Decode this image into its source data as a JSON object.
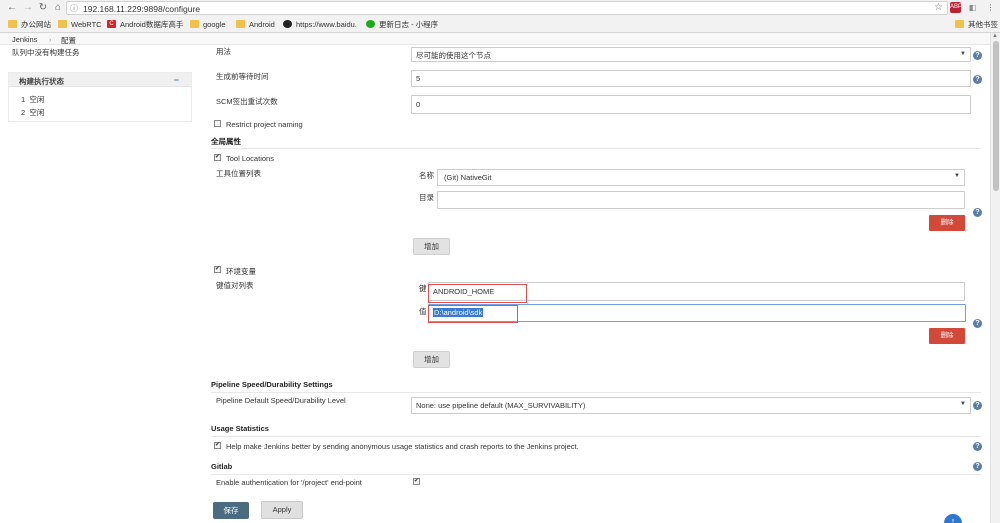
{
  "browser": {
    "url": "192.168.11.229:9898/configure",
    "bookmarks": [
      "办公网站",
      "WebRTC",
      "Android数据库高手",
      "google",
      "Android",
      "https://www.baidu.",
      "更新日志 - 小程序"
    ],
    "other_bookmarks": "其他书签"
  },
  "breadcrumb": {
    "root": "Jenkins",
    "sep": "›",
    "current": "配置"
  },
  "sidebar": {
    "queue_message": "队列中没有构建任务",
    "executor_title": "构建执行状态",
    "collapse_symbol": "−",
    "executors": [
      {
        "num": "1",
        "status": "空闲"
      },
      {
        "num": "2",
        "status": "空闲"
      }
    ]
  },
  "form": {
    "usage_label": "用法",
    "usage_value": "尽可能的使用这个节点",
    "quiet_period_label": "生成前等待时间",
    "quiet_period_value": "5",
    "scm_retry_label": "SCM签出重试次数",
    "scm_retry_value": "0",
    "restrict_naming_label": "Restrict project naming",
    "global_props_title": "全局属性",
    "tool_locations_label": "Tool Locations",
    "tool_list_label": "工具位置列表",
    "tool_name_label": "名称",
    "tool_name_value": "(Git) NativeGit",
    "tool_dir_label": "目录",
    "tool_dir_value": "",
    "delete_label": "删除",
    "add_label": "增加",
    "env_vars_label": "环境变量",
    "kv_list_label": "键值对列表",
    "key_label": "键",
    "key_value": "ANDROID_HOME",
    "value_label": "值",
    "value_value": "D:\\android\\sdk",
    "pipeline_title": "Pipeline Speed/Durability Settings",
    "pipeline_level_label": "Pipeline Default Speed/Durability Level",
    "pipeline_level_value": "None: use pipeline default (MAX_SURVIVABILITY)",
    "usage_stats_title": "Usage Statistics",
    "usage_stats_label": "Help make Jenkins better by sending anonymous usage statistics and crash reports to the Jenkins project.",
    "gitlab_title": "Gitlab",
    "gitlab_auth_label": "Enable authentication for '/project' end-point",
    "checkmark": "✔",
    "help_symbol": "?",
    "caret": "▼"
  },
  "buttons": {
    "save": "保存",
    "apply": "Apply"
  },
  "colors": {
    "help": "#5a7ea9",
    "delete": "#d24939",
    "save": "#4a6b82",
    "highlight": "#e05050"
  }
}
